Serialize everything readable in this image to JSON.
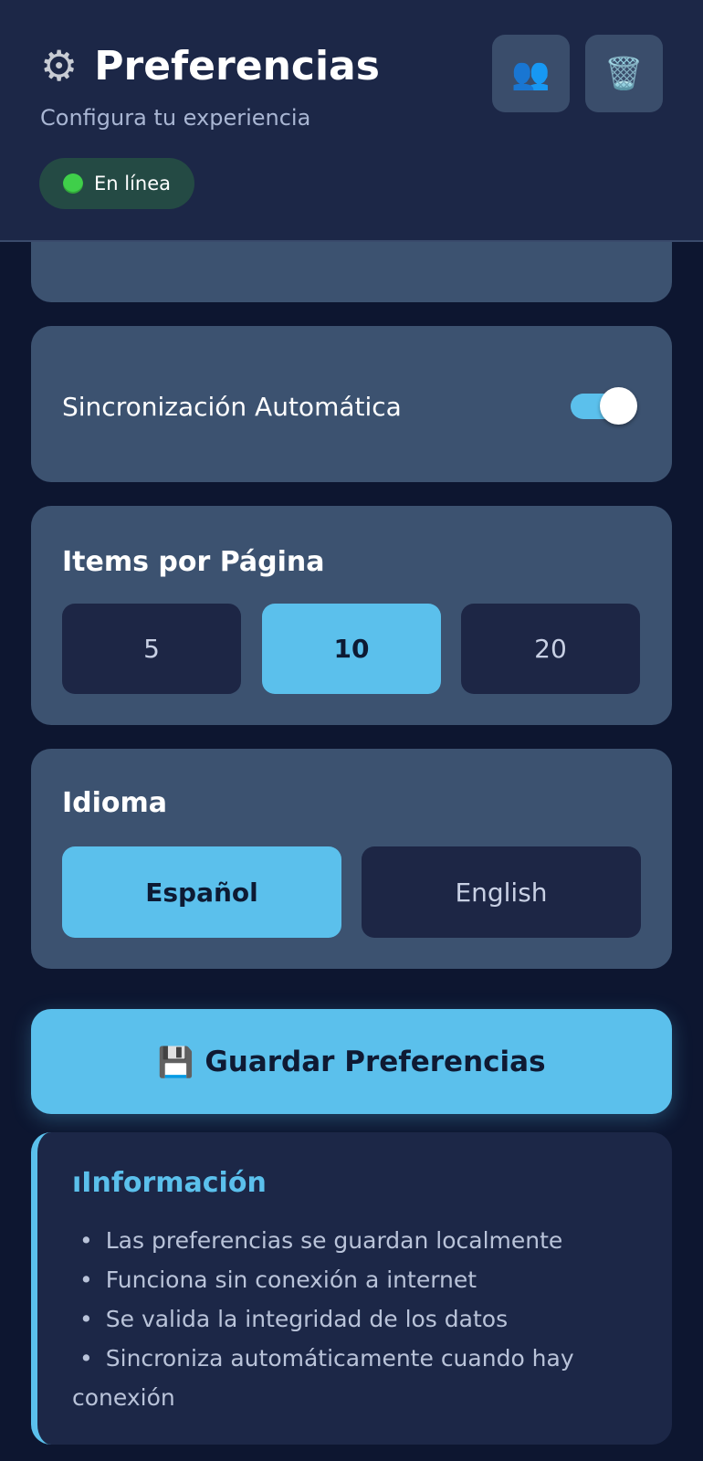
{
  "header": {
    "title": "Preferencias",
    "subtitle": "Configura tu experiencia",
    "status": "En línea",
    "buttons": [
      {
        "icon": "users-icon"
      },
      {
        "icon": "trash-icon"
      }
    ]
  },
  "sync": {
    "label": "Sincronización Automática",
    "enabled": true
  },
  "items_per_page": {
    "title": "Items por Página",
    "options": [
      "5",
      "10",
      "20"
    ],
    "selected": "10"
  },
  "language": {
    "title": "Idioma",
    "options": [
      "Español",
      "English"
    ],
    "selected": "Español"
  },
  "save_button": {
    "label": "Guardar Preferencias",
    "icon": "floppy-disk-icon"
  },
  "info": {
    "title": "Información",
    "items": [
      "Las preferencias se guardan localmente",
      "Funciona sin conexión a internet",
      "Se valida la integridad de los datos",
      "Sincroniza automáticamente cuando hay conexión"
    ]
  },
  "colors": {
    "accent": "#5bc0ec",
    "background": "#0d1630",
    "card": "#3c5270",
    "header": "#1c2747",
    "status_dot": "#3fcf4a"
  }
}
